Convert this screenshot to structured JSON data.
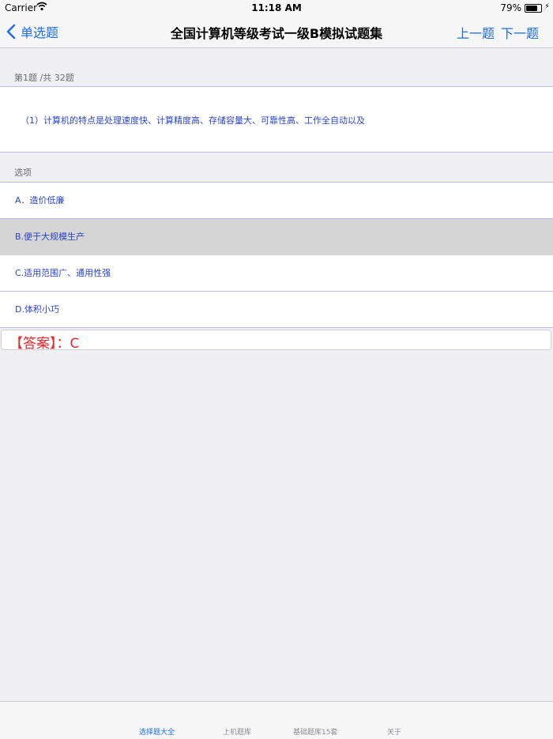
{
  "status_bar": {
    "carrier": "Carrier",
    "time": "11:18 AM",
    "battery_percent": "79%",
    "battery_level": 0.79
  },
  "nav": {
    "back_label": "单选题",
    "title": "全国计算机等级考试一级B模拟试题集",
    "prev_label": "上一题",
    "next_label": "下一题"
  },
  "question": {
    "progress": "第1题 /共 32题",
    "text": "（1）计算机的特点是处理速度快、计算精度高、存储容量大、可靠性高、工作全自动以及"
  },
  "options_header": "选项",
  "options": [
    {
      "label": "A．造价低廉",
      "selected": false
    },
    {
      "label": "B.便于大规模生产",
      "selected": true
    },
    {
      "label": "C.适用范围广、通用性强",
      "selected": false
    },
    {
      "label": "D.体积小巧",
      "selected": false
    }
  ],
  "answer": "【答案】：C",
  "tabs": [
    {
      "label": "选择题大全",
      "active": true
    },
    {
      "label": "上机题库",
      "active": false
    },
    {
      "label": "基础题库15套",
      "active": false
    },
    {
      "label": "关于",
      "active": false
    }
  ],
  "colors": {
    "accent": "#1a6cf0",
    "option_text": "#2a44c8",
    "answer_red": "#e8262c",
    "selected_bg": "#d5d5d5"
  }
}
